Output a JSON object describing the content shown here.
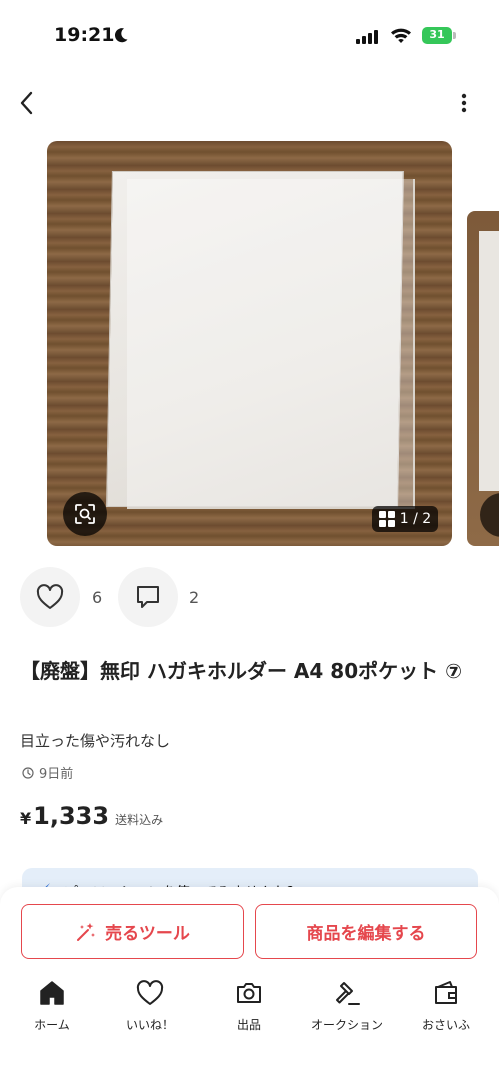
{
  "status_bar": {
    "time": "19:21",
    "battery": "31"
  },
  "gallery": {
    "counter": "1 / 2"
  },
  "reactions": {
    "likes": "6",
    "comments": "2"
  },
  "item": {
    "title": "【廃盤】無印 ハガキホルダー A4 80ポケット ⑦",
    "condition_note": "目立った傷や汚れなし",
    "posted": "9日前",
    "price_symbol": "¥",
    "price": "1,333",
    "shipping": "送料込み"
  },
  "promo": {
    "text": "プロモーションを使ってみませんか？"
  },
  "buttons": {
    "sell_tools": "売るツール",
    "edit_item": "商品を編集する"
  },
  "tabbar": {
    "items": [
      {
        "label": "ホーム",
        "icon": "home-icon"
      },
      {
        "label": "いいね！",
        "icon": "heart-icon"
      },
      {
        "label": "出品",
        "icon": "camera-icon"
      },
      {
        "label": "オークション",
        "icon": "gavel-icon"
      },
      {
        "label": "おさいふ",
        "icon": "wallet-icon"
      }
    ]
  },
  "colors": {
    "accent": "#e5474d",
    "battery": "#35c759",
    "promo_bg": "#e4eef9"
  }
}
